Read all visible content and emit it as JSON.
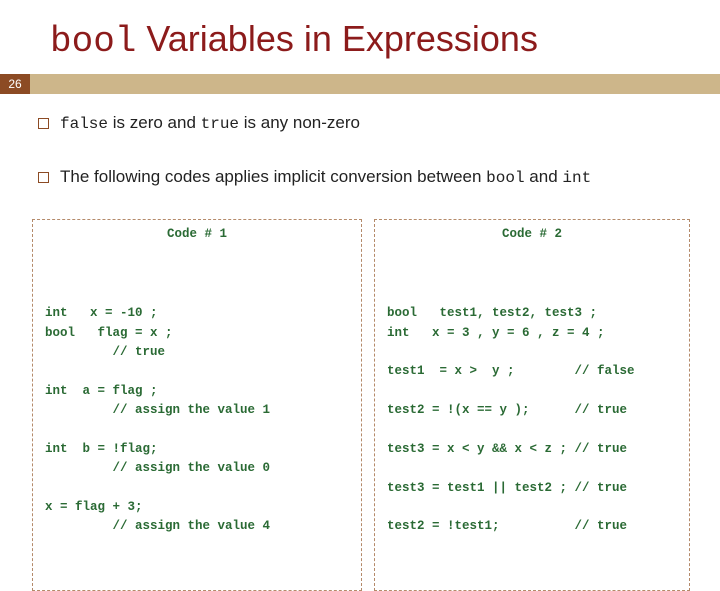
{
  "title": {
    "mono": "bool",
    "rest": " Variables in Expressions"
  },
  "page_number": "26",
  "bullets": {
    "b1": {
      "m1": "false",
      "t1": " is zero and ",
      "m2": "true",
      "t2": " is any non-zero"
    },
    "b2": {
      "t1": "The following codes applies implicit conversion between ",
      "m1": "bool",
      "t2": " and ",
      "m2": "int"
    }
  },
  "code1": {
    "label": "Code # 1",
    "body": "int   x = -10 ;\nbool   flag = x ;\n         // true\n\nint  a = flag ;\n         // assign the value 1\n\nint  b = !flag;\n         // assign the value 0\n\nx = flag + 3;\n         // assign the value 4"
  },
  "code2": {
    "label": "Code # 2",
    "body": "bool   test1, test2, test3 ;\nint   x = 3 , y = 6 , z = 4 ;\n\ntest1  = x >  y ;        // false\n\ntest2 = !(x == y );      // true\n\ntest3 = x < y && x < z ; // true\n\ntest3 = test1 || test2 ; // true\n\ntest2 = !test1;          // true"
  }
}
